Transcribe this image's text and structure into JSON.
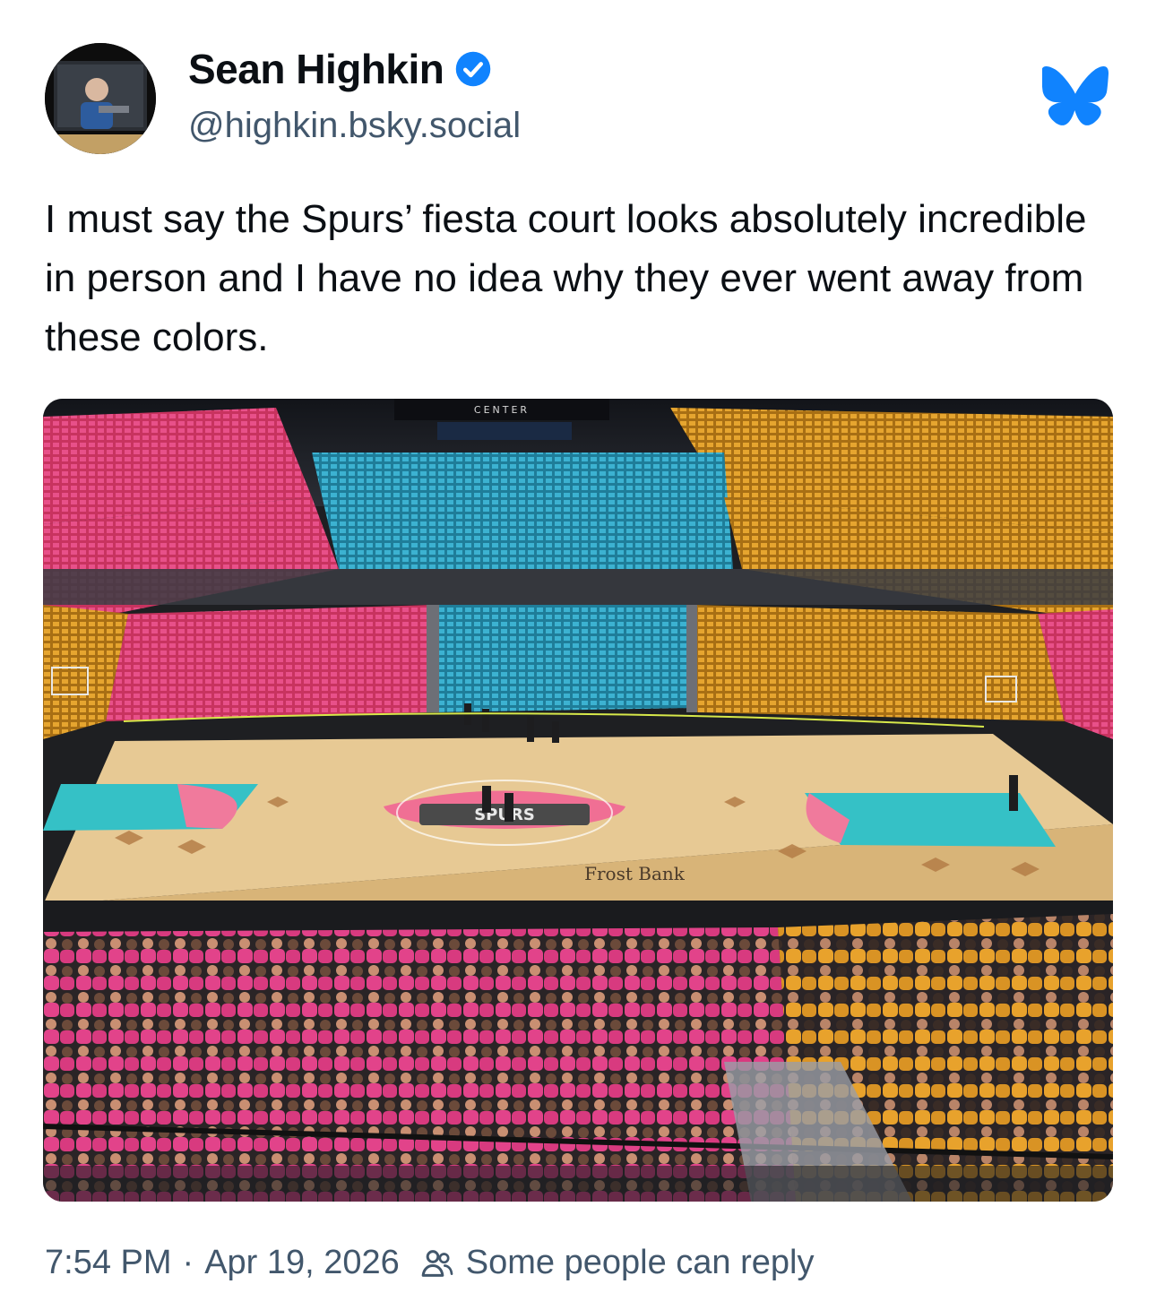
{
  "author": {
    "display_name": "Sean Highkin",
    "handle": "@highkin.bsky.social",
    "verified": true,
    "avatar_icon": "avatar-image"
  },
  "post": {
    "text": "I must say the Spurs’ fiesta court looks absolutely incredible in person and I have no idea why they ever went away from these colors.",
    "time": "7:54 PM",
    "separator": "·",
    "date": "Apr 19, 2026",
    "reply_setting": "Some people can reply"
  },
  "photo": {
    "scoreboard_text": "CENTER",
    "court_logo_text": "SPURS",
    "sponsor_text": "Frost Bank"
  },
  "icons": {
    "verified": "verified-check-icon",
    "app": "bluesky-butterfly-icon",
    "reply": "people-icon"
  },
  "colors": {
    "accent": "#1083fe",
    "secondary_text": "#42576c",
    "fiesta_pink": "#e0427a",
    "fiesta_teal": "#2fa9c4",
    "fiesta_gold": "#e0a02e"
  }
}
